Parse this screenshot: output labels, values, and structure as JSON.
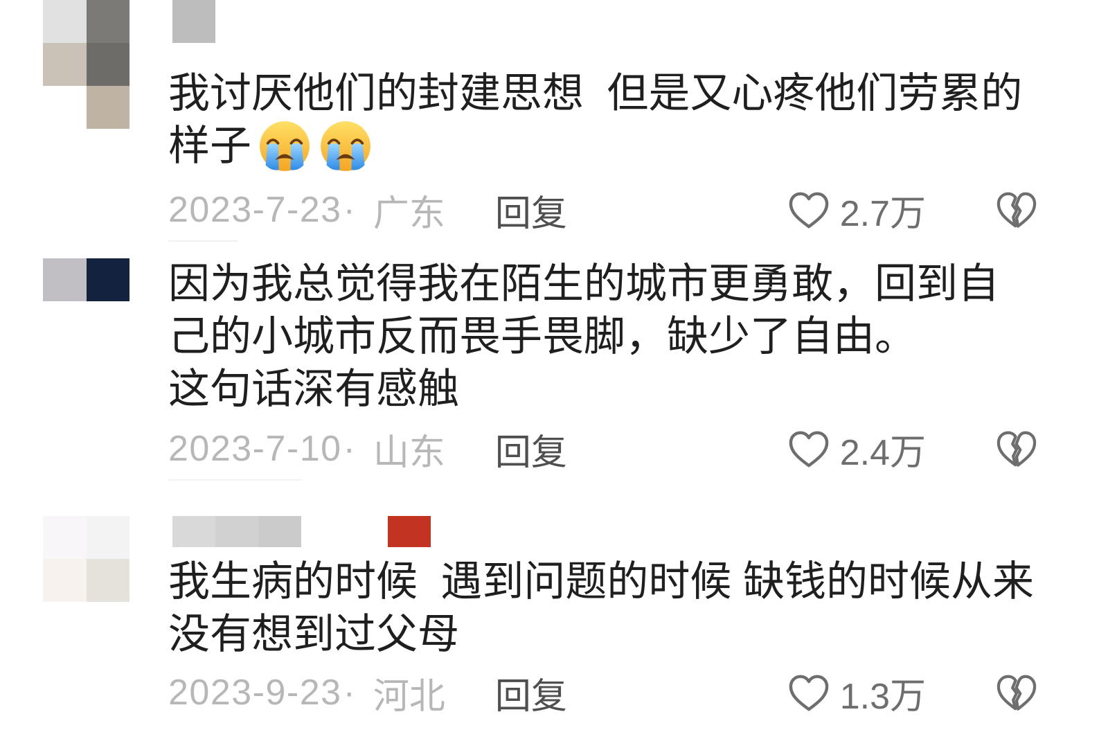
{
  "labels": {
    "reply": "回复"
  },
  "meta_separator": "·",
  "comments": [
    {
      "avatar_mosaic": [
        [
          "#e1e1e1",
          "#7b7a76"
        ],
        [
          "#cac1b7",
          "#6d6c68"
        ],
        [
          "#ffffff",
          "#bfb3a4"
        ]
      ],
      "username_redaction": [
        "#bdbdbd"
      ],
      "lines": [
        "我讨厌他们的封建思想  但是又心疼他们劳累的",
        "样子"
      ],
      "emojis": [
        "loudly-crying-face-icon",
        "loudly-crying-face-icon"
      ],
      "date": "2023-7-23",
      "location": "广东",
      "likes": "2.7万",
      "like_icon": "heart-outline-icon",
      "dislike_icon": "broken-heart-icon"
    },
    {
      "avatar_mosaic": [
        [
          "#c1bfc4",
          "#13223f"
        ]
      ],
      "username_redaction": [],
      "lines": [
        "因为我总觉得我在陌生的城市更勇敢，回到自",
        "己的小城市反而畏手畏脚，缺少了自由。",
        "这句话深有感触"
      ],
      "date": "2023-7-10",
      "location": "山东",
      "likes": "2.4万",
      "like_icon": "heart-outline-icon",
      "dislike_icon": "broken-heart-icon"
    },
    {
      "avatar_mosaic": [
        [
          "#f8f6f8",
          "#f4f3f4"
        ],
        [
          "#f7f2ee",
          "#e5e2db"
        ]
      ],
      "username_redaction": [
        "#d9d9d9",
        "#d1d1d1",
        "#cbcbcb"
      ],
      "badge_color": "#c23322",
      "lines": [
        "我生病的时候  遇到问题的时候 缺钱的时候从来",
        "没有想到过父母"
      ],
      "date": "2023-9-23",
      "location": "河北",
      "likes": "1.3万",
      "like_icon": "heart-outline-icon",
      "dislike_icon": "broken-heart-icon"
    }
  ]
}
